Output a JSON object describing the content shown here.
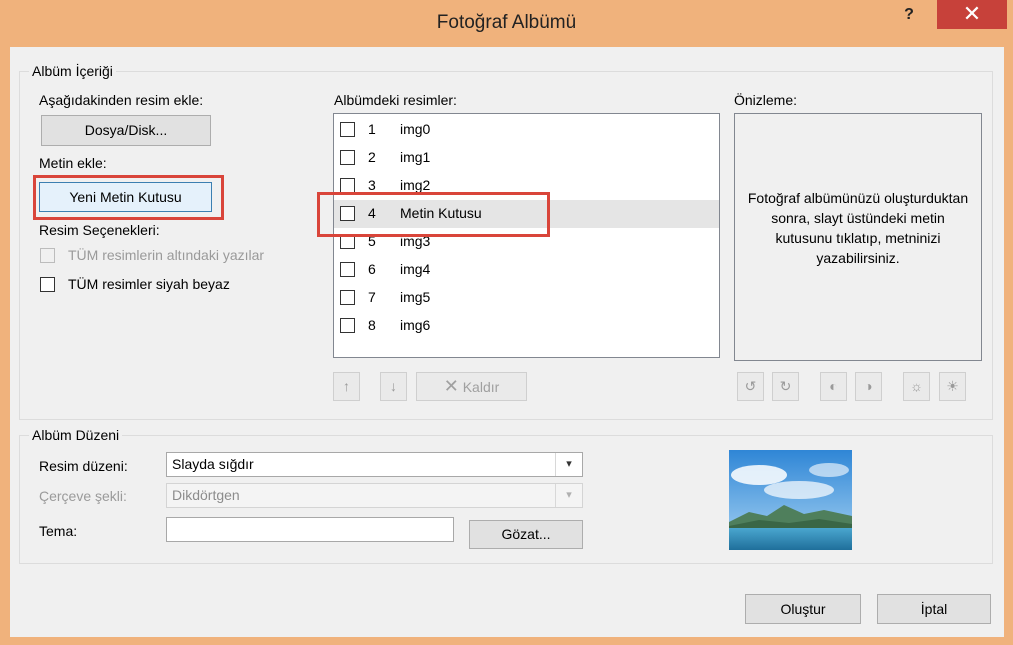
{
  "window": {
    "title": "Fotoğraf Albümü",
    "help_label": "?",
    "close_label": "✕"
  },
  "album_content": {
    "group_label": "Albüm İçeriği",
    "add_picture_label": "Aşağıdakinden resim ekle:",
    "file_disk_button": "Dosya/Disk...",
    "insert_text_label": "Metin ekle:",
    "new_textbox_button": "Yeni Metin Kutusu",
    "picture_options_label": "Resim Seçenekleri:",
    "captions_below_label": "TÜM resimlerin altındaki yazılar",
    "black_white_label": "TÜM resimler siyah beyaz",
    "pictures_in_album_label": "Albümdeki resimler:",
    "pictures": [
      {
        "num": "1",
        "name": "img0"
      },
      {
        "num": "2",
        "name": "img1"
      },
      {
        "num": "3",
        "name": "img2"
      },
      {
        "num": "4",
        "name": "Metin Kutusu"
      },
      {
        "num": "5",
        "name": "img3"
      },
      {
        "num": "6",
        "name": "img4"
      },
      {
        "num": "7",
        "name": "img5"
      },
      {
        "num": "8",
        "name": "img6"
      }
    ],
    "remove_button": "Kaldır",
    "preview_label": "Önizleme:",
    "preview_text": "Fotoğraf albümünüzü oluşturduktan sonra, slayt üstündeki metin kutusunu tıklatıp, metninizi yazabilirsiniz."
  },
  "album_layout": {
    "group_label": "Albüm Düzeni",
    "picture_layout_label": "Resim düzeni:",
    "picture_layout_value": "Slayda sığdır",
    "frame_shape_label": "Çerçeve şekli:",
    "frame_shape_value": "Dikdörtgen",
    "theme_label": "Tema:",
    "theme_value": "",
    "browse_button": "Gözat..."
  },
  "footer": {
    "create_button": "Oluştur",
    "cancel_button": "İptal"
  },
  "colors": {
    "title_bar": "#f0b27c",
    "close_button": "#c7413a",
    "highlight_box": "#d9453a"
  }
}
